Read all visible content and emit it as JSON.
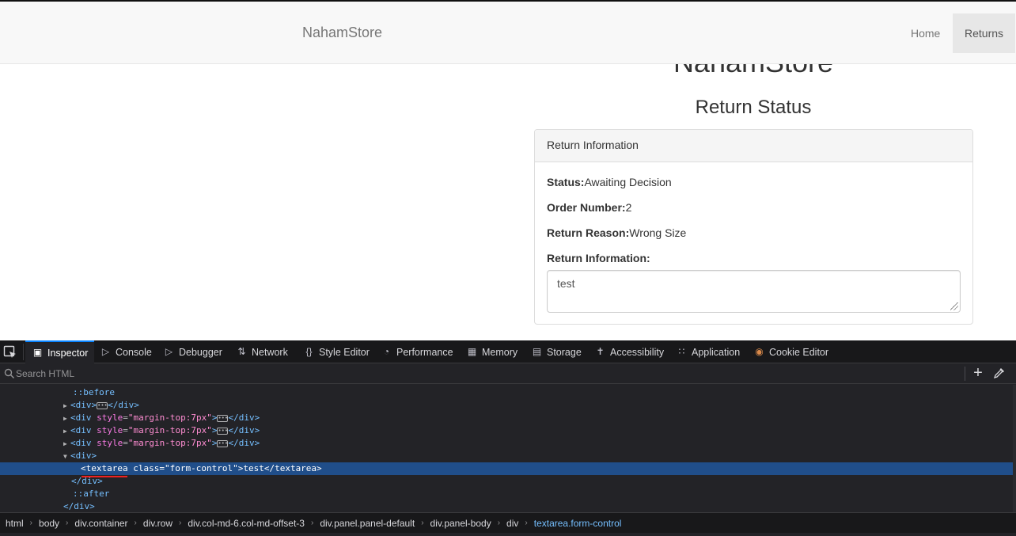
{
  "navbar": {
    "brand": "NahamStore",
    "home": "Home",
    "returns": "Returns"
  },
  "main": {
    "big_title": "NahamStore",
    "section_title": "Return Status",
    "panel_heading": "Return Information",
    "status_label": "Status:",
    "status_value": "Awaiting Decision",
    "order_label": "Order Number:",
    "order_value": "2",
    "reason_label": "Return Reason:",
    "reason_value": "Wrong Size",
    "info_label": "Return Information:",
    "info_value": "test"
  },
  "devtools": {
    "tabs": [
      "Inspector",
      "Console",
      "Debugger",
      "Network",
      "Style Editor",
      "Performance",
      "Memory",
      "Storage",
      "Accessibility",
      "Application",
      "Cookie Editor"
    ],
    "search_placeholder": "Search HTML",
    "tree": {
      "before": "::before",
      "div_open": "<div>",
      "div_close": "</div>",
      "div_mt_open": "<div",
      "attr_style": "style",
      "attr_style_val": "\"margin-top:7px\"",
      "textarea_open": "<textarea",
      "attr_class": "class",
      "attr_class_val": "\"form-control\"",
      "textarea_text": "test",
      "textarea_close": "</textarea>",
      "after": "::after"
    },
    "breadcrumbs": [
      "html",
      "body",
      "div.container",
      "div.row",
      "div.col-md-6.col-md-offset-3",
      "div.panel.panel-default",
      "div.panel-body",
      "div",
      "textarea.form-control"
    ]
  }
}
